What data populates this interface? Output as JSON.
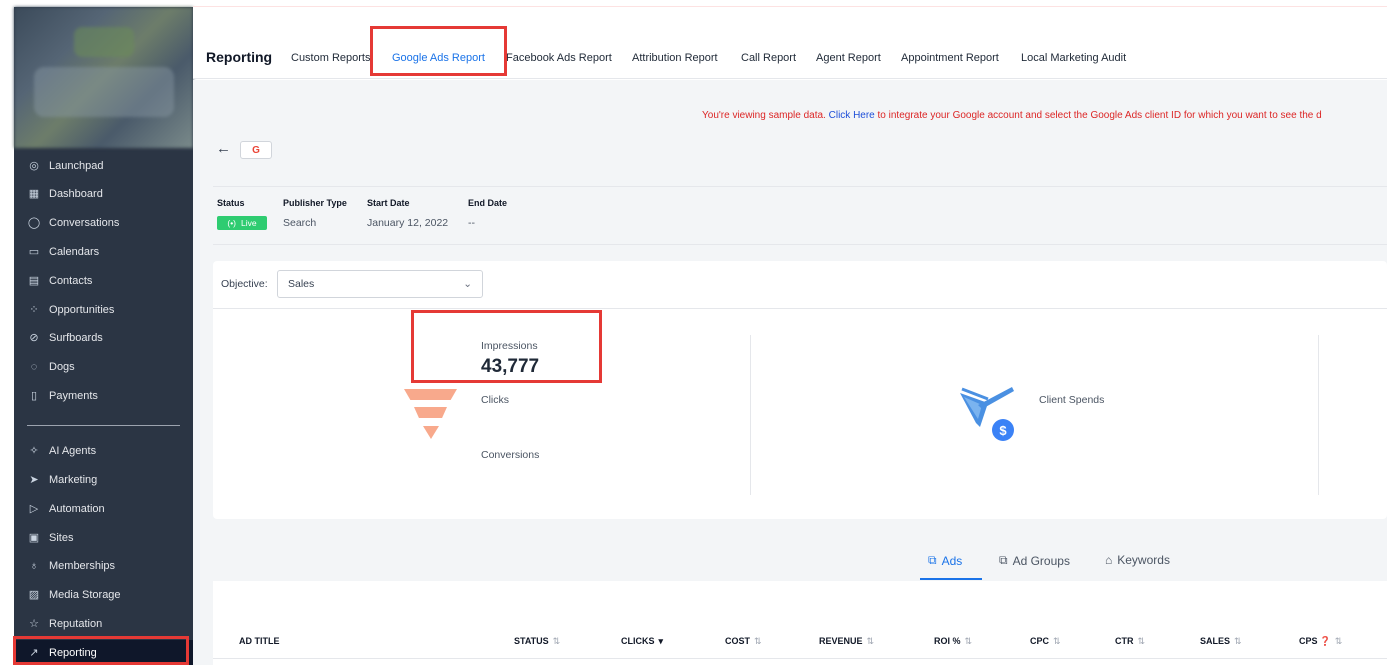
{
  "sidebar": {
    "items": [
      {
        "label": "Launchpad",
        "icon": "rocket-icon"
      },
      {
        "label": "Dashboard",
        "icon": "grid-icon"
      },
      {
        "label": "Conversations",
        "icon": "chat-icon"
      },
      {
        "label": "Calendars",
        "icon": "calendar-icon"
      },
      {
        "label": "Contacts",
        "icon": "contacts-icon"
      },
      {
        "label": "Opportunities",
        "icon": "opportunities-icon"
      },
      {
        "label": "Surfboards",
        "icon": "surfboard-icon"
      },
      {
        "label": "Dogs",
        "icon": "dog-icon"
      },
      {
        "label": "Payments",
        "icon": "payments-icon"
      },
      {
        "label": "AI Agents",
        "icon": "sparkle-icon"
      },
      {
        "label": "Marketing",
        "icon": "send-icon"
      },
      {
        "label": "Automation",
        "icon": "play-icon"
      },
      {
        "label": "Sites",
        "icon": "sites-icon"
      },
      {
        "label": "Memberships",
        "icon": "award-icon"
      },
      {
        "label": "Media Storage",
        "icon": "image-icon"
      },
      {
        "label": "Reputation",
        "icon": "star-icon"
      },
      {
        "label": "Reporting",
        "icon": "chart-line-icon"
      }
    ]
  },
  "header": {
    "title": "Reporting",
    "tabs": [
      {
        "label": "Custom Reports"
      },
      {
        "label": "Google Ads Report"
      },
      {
        "label": "Facebook Ads Report"
      },
      {
        "label": "Attribution Report"
      },
      {
        "label": "Call Report"
      },
      {
        "label": "Agent Report"
      },
      {
        "label": "Appointment Report"
      },
      {
        "label": "Local Marketing Audit"
      }
    ]
  },
  "notice": {
    "before": "You're viewing sample data. ",
    "link": "Click Here",
    "after": " to integrate your Google account and select the Google Ads client ID for which you want to see the d"
  },
  "campaign": {
    "chip": "G",
    "status_label": "Status",
    "status_value": "Live",
    "publisher_label": "Publisher Type",
    "publisher_value": "Search",
    "start_label": "Start Date",
    "start_value": "January 12, 2022",
    "end_label": "End Date",
    "end_value": "--"
  },
  "objective": {
    "label": "Objective:",
    "value": "Sales"
  },
  "metrics": {
    "impressions_label": "Impressions",
    "impressions_value": "43,777",
    "clicks_label": "Clicks",
    "conversions_label": "Conversions",
    "client_spends_label": "Client Spends"
  },
  "sub_tabs": [
    {
      "label": "Ads"
    },
    {
      "label": "Ad Groups"
    },
    {
      "label": "Keywords"
    }
  ],
  "table": {
    "columns": [
      "AD TITLE",
      "STATUS",
      "CLICKS",
      "COST",
      "REVENUE",
      "ROI %",
      "CPC",
      "CTR",
      "SALES",
      "CPS"
    ]
  },
  "colors": {
    "sidebar_bg": "#2b3544",
    "accent": "#1a73e8",
    "highlight": "#e53935",
    "funnel": "#f8a98c",
    "live": "#2ecc71"
  }
}
